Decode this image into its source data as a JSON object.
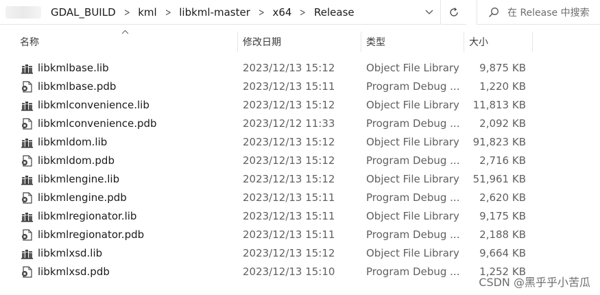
{
  "address_bar": {
    "breadcrumbs": [
      "GDAL_BUILD",
      "kml",
      "libkml-master",
      "x64",
      "Release"
    ]
  },
  "search": {
    "placeholder": "在 Release 中搜索"
  },
  "columns": {
    "name": "名称",
    "date": "修改日期",
    "type": "类型",
    "size": "大小"
  },
  "files": [
    {
      "name": "libkmlbase.lib",
      "date": "2023/12/13 15:12",
      "type": "Object File Library",
      "size": "9,875 KB",
      "icon": "lib-file-icon"
    },
    {
      "name": "libkmlbase.pdb",
      "date": "2023/12/13 15:11",
      "type": "Program Debug ...",
      "size": "1,220 KB",
      "icon": "pdb-file-icon"
    },
    {
      "name": "libkmlconvenience.lib",
      "date": "2023/12/13 15:12",
      "type": "Object File Library",
      "size": "11,813 KB",
      "icon": "lib-file-icon"
    },
    {
      "name": "libkmlconvenience.pdb",
      "date": "2023/12/12 11:33",
      "type": "Program Debug ...",
      "size": "2,092 KB",
      "icon": "pdb-file-icon"
    },
    {
      "name": "libkmldom.lib",
      "date": "2023/12/13 15:12",
      "type": "Object File Library",
      "size": "91,823 KB",
      "icon": "lib-file-icon"
    },
    {
      "name": "libkmldom.pdb",
      "date": "2023/12/13 15:12",
      "type": "Program Debug ...",
      "size": "2,716 KB",
      "icon": "pdb-file-icon"
    },
    {
      "name": "libkmlengine.lib",
      "date": "2023/12/13 15:12",
      "type": "Object File Library",
      "size": "51,961 KB",
      "icon": "lib-file-icon"
    },
    {
      "name": "libkmlengine.pdb",
      "date": "2023/12/13 15:11",
      "type": "Program Debug ...",
      "size": "2,620 KB",
      "icon": "pdb-file-icon"
    },
    {
      "name": "libkmlregionator.lib",
      "date": "2023/12/13 15:11",
      "type": "Object File Library",
      "size": "9,175 KB",
      "icon": "lib-file-icon"
    },
    {
      "name": "libkmlregionator.pdb",
      "date": "2023/12/13 15:11",
      "type": "Program Debug ...",
      "size": "2,188 KB",
      "icon": "pdb-file-icon"
    },
    {
      "name": "libkmlxsd.lib",
      "date": "2023/12/13 15:12",
      "type": "Object File Library",
      "size": "9,664 KB",
      "icon": "lib-file-icon"
    },
    {
      "name": "libkmlxsd.pdb",
      "date": "2023/12/13 15:10",
      "type": "Program Debug ...",
      "size": "1,252 KB",
      "icon": "pdb-file-icon"
    }
  ],
  "watermark": "CSDN @黑乎乎小苦瓜"
}
